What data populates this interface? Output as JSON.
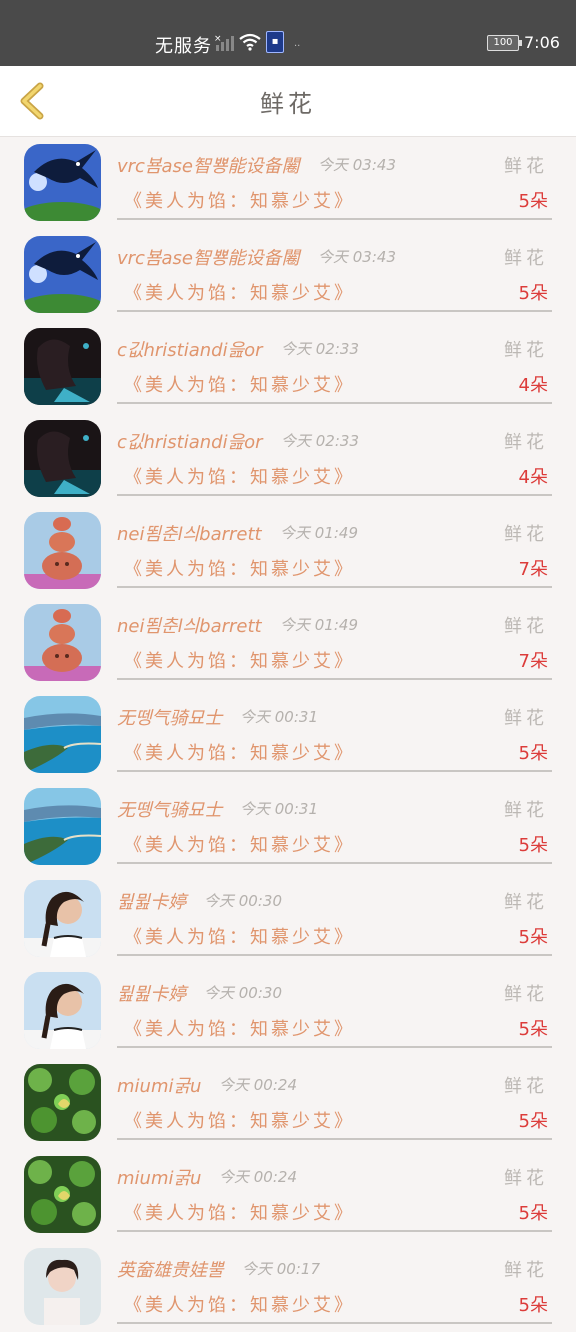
{
  "status_bar": {
    "carrier": "无服务",
    "time": "7:06",
    "battery": "100"
  },
  "header": {
    "title": "鲜花"
  },
  "rows": [
    {
      "name": "vrc뵴ase智뿅能设备闂",
      "time": "今天 03:43",
      "label": "鲜花",
      "book": "《美人为馅：知慕少艾》",
      "qty": "5朵",
      "avatar": "swallow"
    },
    {
      "name": "vrc뵴ase智뿅能设备闂",
      "time": "今天 03:43",
      "label": "鲜花",
      "book": "《美人为馅：知慕少艾》",
      "qty": "5朵",
      "avatar": "swallow"
    },
    {
      "name": "c깂hristiandi읊or",
      "time": "今天 02:33",
      "label": "鲜花",
      "book": "《美人为馅：知慕少艾》",
      "qty": "4朵",
      "avatar": "dark"
    },
    {
      "name": "c깂hristiandi읊or",
      "time": "今天 02:33",
      "label": "鲜花",
      "book": "《美人为馅：知慕少艾》",
      "qty": "4朵",
      "avatar": "dark"
    },
    {
      "name": "nei뙴춘l싀barrett",
      "time": "今天 01:49",
      "label": "鲜花",
      "book": "《美人为馅：知慕少艾》",
      "qty": "7朵",
      "avatar": "totem"
    },
    {
      "name": "nei뙴춘l싀barrett",
      "time": "今天 01:49",
      "label": "鲜花",
      "book": "《美人为馅：知慕少艾》",
      "qty": "7朵",
      "avatar": "totem"
    },
    {
      "name": "无뗑气骑묘士",
      "time": "今天 00:31",
      "label": "鲜花",
      "book": "《美人为馅：知慕少艾》",
      "qty": "5朵",
      "avatar": "coast"
    },
    {
      "name": "无뗑气骑묘士",
      "time": "今天 00:31",
      "label": "鲜花",
      "book": "《美人为馅：知慕少艾》",
      "qty": "5朵",
      "avatar": "coast"
    },
    {
      "name": "뮖뮖卡婷",
      "time": "今天 00:30",
      "label": "鲜花",
      "book": "《美人为馅：知慕少艾》",
      "qty": "5朵",
      "avatar": "girl"
    },
    {
      "name": "뮖뮖卡婷",
      "time": "今天 00:30",
      "label": "鲜花",
      "book": "《美人为馅：知慕少艾》",
      "qty": "5朵",
      "avatar": "girl"
    },
    {
      "name": "miumi굵u",
      "time": "今天 00:24",
      "label": "鲜花",
      "book": "《美人为馅：知慕少艾》",
      "qty": "5朵",
      "avatar": "clover"
    },
    {
      "name": "miumi굵u",
      "time": "今天 00:24",
      "label": "鲜花",
      "book": "《美人为馅：知慕少艾》",
      "qty": "5朵",
      "avatar": "clover"
    },
    {
      "name": "英奤雄贵娃뿔",
      "time": "今天 00:17",
      "label": "鲜花",
      "book": "《美人为馅：知慕少艾》",
      "qty": "5朵",
      "avatar": "woman"
    }
  ],
  "colors": {
    "accent": "#e0956d",
    "quantity": "#dc3c3a",
    "back_arrow": "#e8c15a"
  }
}
